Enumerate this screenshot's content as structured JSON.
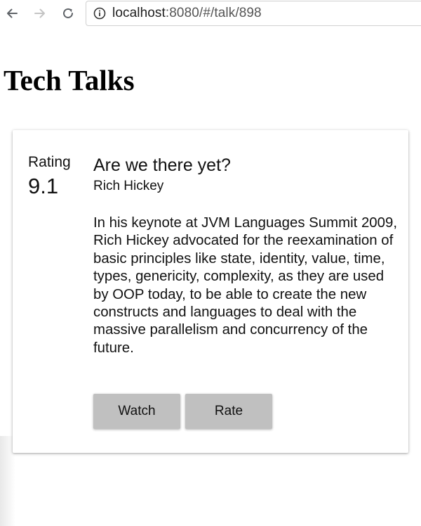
{
  "browser": {
    "url_host": "localhost",
    "url_rest": ":8080/#/talk/898",
    "icons": [
      "back-arrow-icon",
      "forward-arrow-icon",
      "reload-icon",
      "info-icon"
    ]
  },
  "page": {
    "title": "Tech Talks"
  },
  "talk": {
    "rating_label": "Rating",
    "rating_value": "9.1",
    "title": "Are we there yet?",
    "speaker": "Rich Hickey",
    "description": "In his keynote at JVM Languages Summit 2009, Rich Hickey advocated for the reexamination of basic principles like state, identity, value, time, types, genericity, complexity, as they are used by OOP today, to be able to create the new constructs and languages to deal with the massive parallelism and concurrency of the future.",
    "watch_label": "Watch",
    "rate_label": "Rate"
  }
}
